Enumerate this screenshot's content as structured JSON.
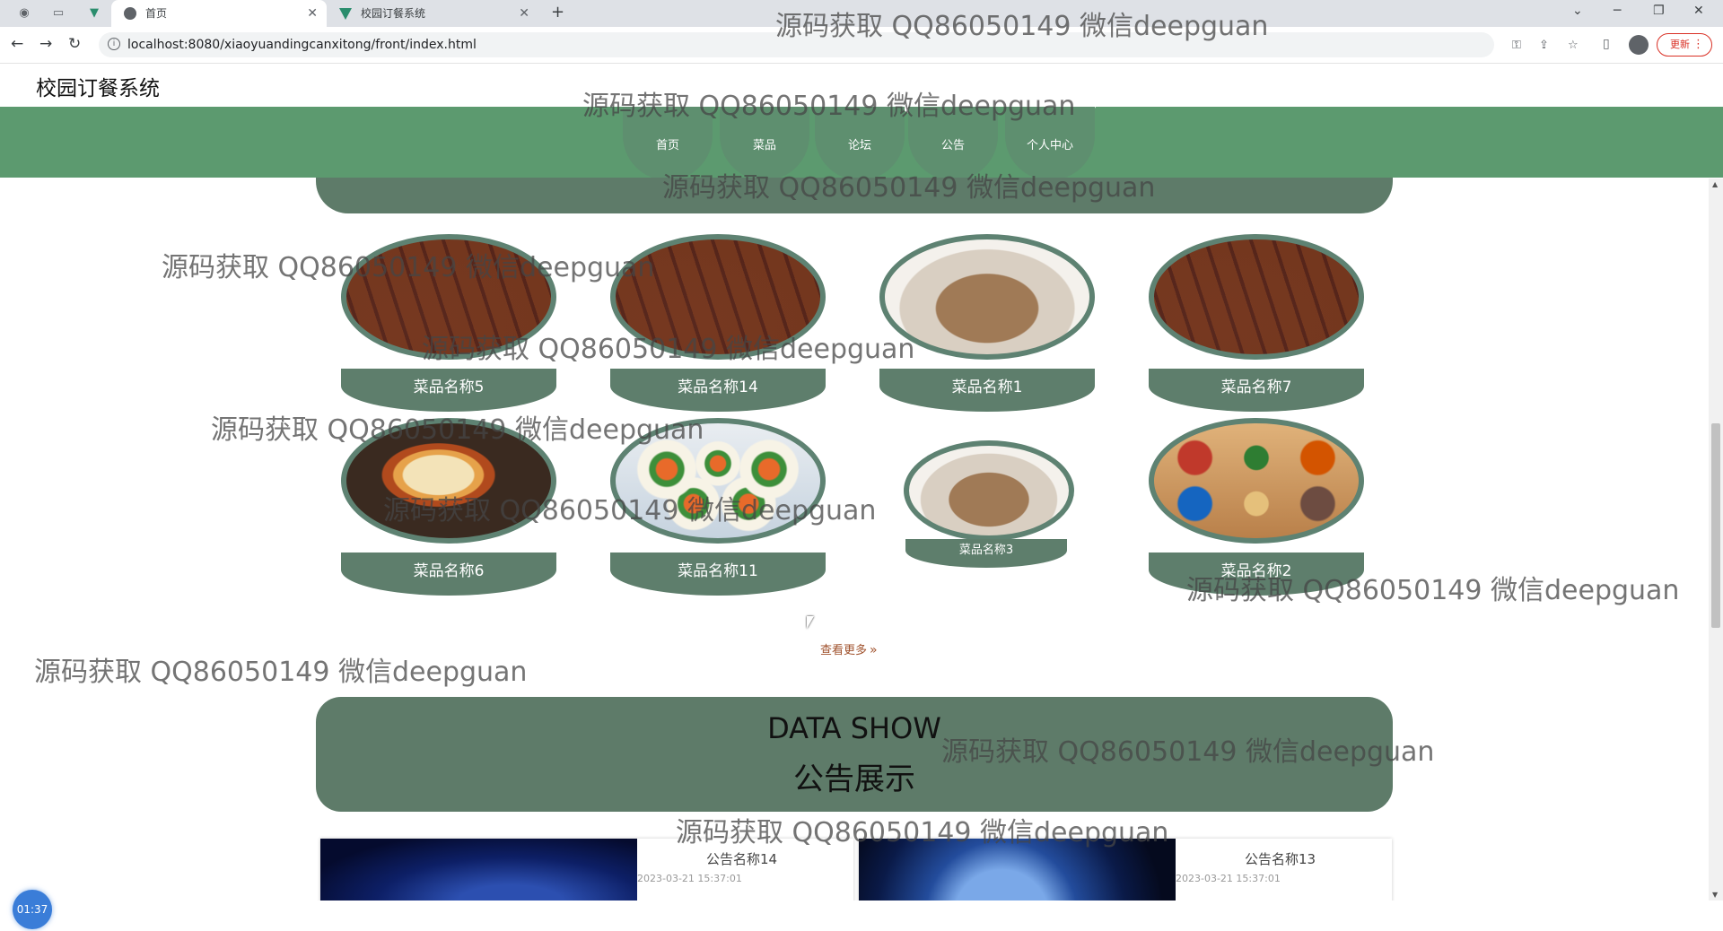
{
  "browser": {
    "tabs": [
      {
        "label": "首页",
        "active": true
      },
      {
        "label": "校园订餐系统",
        "active": false
      }
    ],
    "url": "localhost:8080/xiaoyuandingcanxitong/front/index.html",
    "update_label": "更新",
    "new_tab": "+"
  },
  "site": {
    "title": "校园订餐系统",
    "nav": [
      "首页",
      "菜品",
      "论坛",
      "公告",
      "个人中心"
    ],
    "theme_color": "#5c9a6f"
  },
  "dishes": {
    "items": [
      "菜品名称5",
      "菜品名称14",
      "菜品名称1",
      "菜品名称7",
      "菜品名称6",
      "菜品名称11",
      "菜品名称3",
      "菜品名称2"
    ],
    "more_label": "查看更多"
  },
  "data_show": {
    "en": "DATA SHOW",
    "zh": "公告展示"
  },
  "notices": [
    {
      "title": "公告名称14",
      "date": "2023-03-21 15:37:01"
    },
    {
      "title": "公告名称13",
      "date": "2023-03-21 15:37:01"
    }
  ],
  "timer": "01:37",
  "watermark": "源码获取 QQ86050149 微信deepguan"
}
